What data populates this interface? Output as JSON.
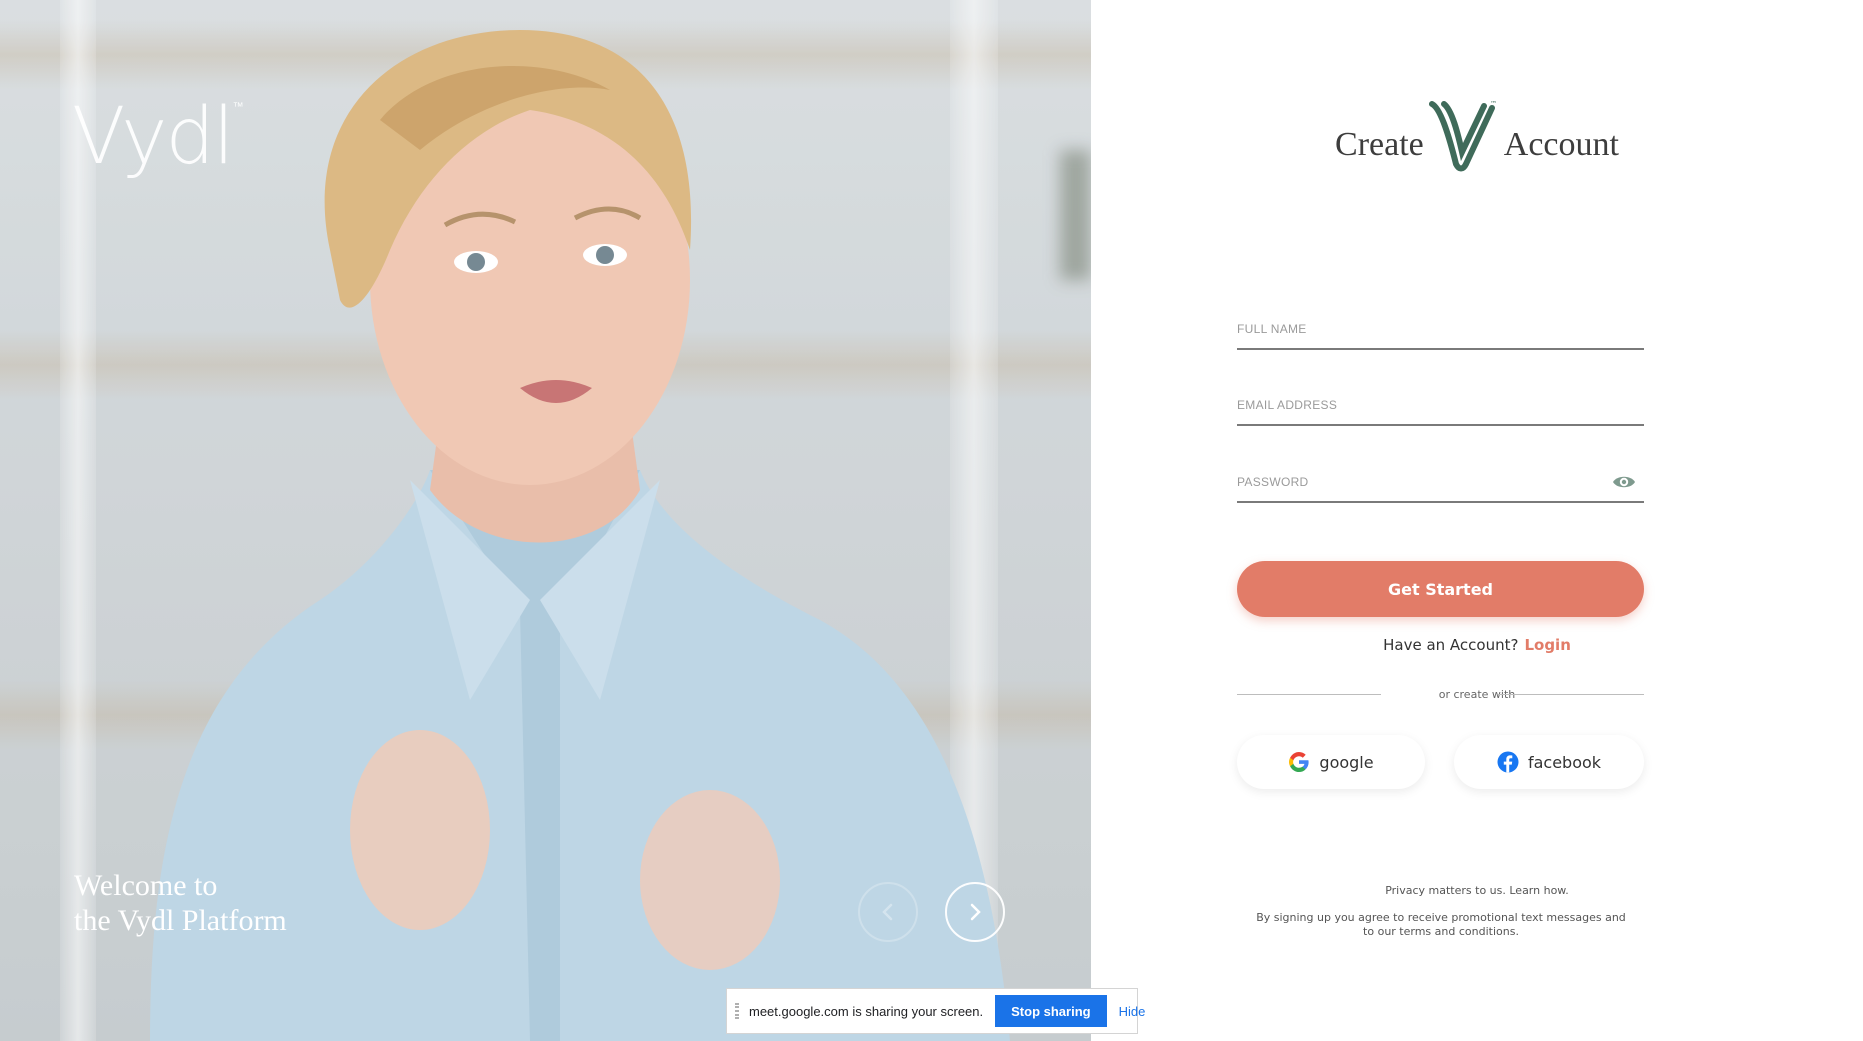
{
  "hero": {
    "brand": "Vydl",
    "trademark": "™",
    "welcome_line1": "Welcome to",
    "welcome_line2": "the Vydl Platform"
  },
  "signup": {
    "title_left": "Create",
    "title_right": "Account",
    "full_name_placeholder": "FULL NAME",
    "email_placeholder": "EMAIL ADDRESS",
    "password_placeholder": "PASSWORD",
    "submit_label": "Get Started",
    "have_account_text": "Have an Account?",
    "login_label": "Login",
    "divider_text": "or create with",
    "google_label": "google",
    "facebook_label": "facebook",
    "privacy_text": "Privacy matters to us. Learn how.",
    "terms_text": "By signing up you agree to receive promotional text messages and to our terms and conditions."
  },
  "share_bar": {
    "message": "meet.google.com is sharing your screen.",
    "stop_label": "Stop sharing",
    "hide_label": "Hide"
  },
  "colors": {
    "accent": "#e27c68",
    "brand_green": "#3f6b5a",
    "share_blue": "#1a73e8"
  },
  "icons": [
    "chevron-left-icon",
    "chevron-right-icon",
    "eye-icon",
    "google-icon",
    "facebook-icon",
    "drag-handle-icon"
  ]
}
